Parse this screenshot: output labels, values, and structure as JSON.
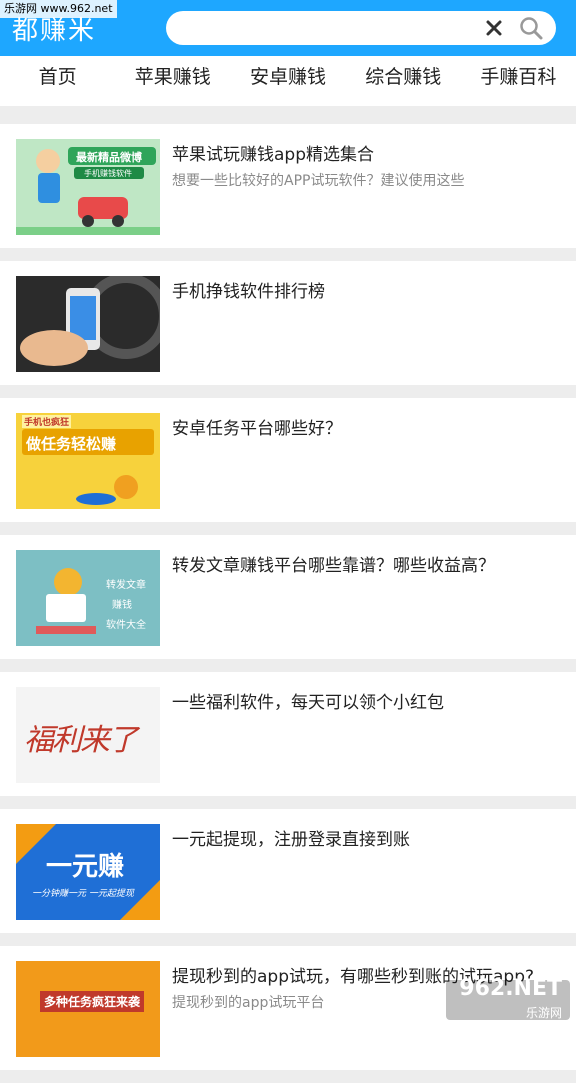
{
  "header": {
    "logo_text": "都赚米",
    "watermark": "乐游网 www.962.net"
  },
  "search": {
    "placeholder": ""
  },
  "nav": {
    "tabs": [
      {
        "label": "首页"
      },
      {
        "label": "苹果赚钱"
      },
      {
        "label": "安卓赚钱"
      },
      {
        "label": "综合赚钱"
      },
      {
        "label": "手赚百科"
      }
    ]
  },
  "articles": [
    {
      "title": "苹果试玩赚钱app精选集合",
      "subtitle": "想要一些比较好的APP试玩软件？建议使用这些",
      "thumb": {
        "banner": "最新精品微博",
        "sub": "手机赚钱软件"
      }
    },
    {
      "title": "手机挣钱软件排行榜",
      "subtitle": "",
      "thumb": {}
    },
    {
      "title": "安卓任务平台哪些好？",
      "subtitle": "",
      "thumb": {
        "tag": "手机也疯狂",
        "main": "做任务轻松赚"
      }
    },
    {
      "title": "转发文章赚钱平台哪些靠谱？哪些收益高？",
      "subtitle": "",
      "thumb": {
        "line1": "转发文章",
        "line2": "赚钱",
        "line3": "软件大全"
      }
    },
    {
      "title": "一些福利软件，每天可以领个小红包",
      "subtitle": "",
      "thumb": {
        "main": "福利来了"
      }
    },
    {
      "title": "一元起提现，注册登录直接到账",
      "subtitle": "",
      "thumb": {
        "main": "一元赚",
        "sub": "一分钟赚一元 一元起提现"
      }
    },
    {
      "title": "提现秒到的app试玩，有哪些秒到账的试玩app?",
      "subtitle": "提现秒到的app试玩平台",
      "thumb": {
        "main": "多种任务疯狂来袭"
      }
    }
  ],
  "footer_watermark": {
    "big": "962.NET",
    "small": "乐游网"
  },
  "colors": {
    "brand": "#1ea7ff",
    "background": "#ededed"
  }
}
